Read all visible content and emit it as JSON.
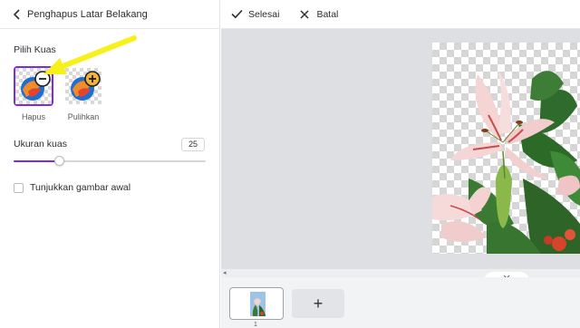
{
  "panel": {
    "title": "Penghapus Latar Belakang",
    "brush_section_label": "Pilih Kuas",
    "brushes": [
      {
        "label": "Hapus",
        "selected": true,
        "icon": "minus-icon"
      },
      {
        "label": "Pulihkan",
        "selected": false,
        "icon": "plus-icon"
      }
    ],
    "size_label": "Ukuran kuas",
    "size_value": "25",
    "size_fraction": 0.24,
    "show_original_label": "Tunjukkan gambar awal",
    "show_original_checked": false
  },
  "toolbar": {
    "done_label": "Selesai",
    "cancel_label": "Batal"
  },
  "filmstrip": {
    "page_number": "1",
    "add_page_label": "+"
  },
  "colors": {
    "accent": "#7d2ae8",
    "annotation_arrow": "#f7f01a"
  }
}
